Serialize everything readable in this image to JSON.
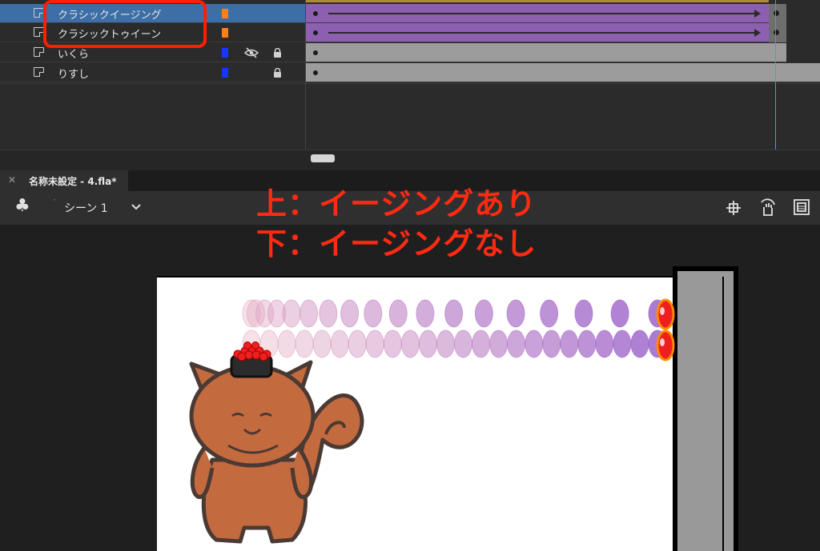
{
  "timeline": {
    "layers": [
      {
        "name": "クラシックイージング",
        "color": "#ff7f1a",
        "selected": true,
        "tween": true,
        "frames_color": "#8c5fb0"
      },
      {
        "name": "クラシックトゥイーン",
        "color": "#ff7f1a",
        "selected": false,
        "tween": true,
        "frames_color": "#8c5fb0"
      },
      {
        "name": "いくら",
        "color": "#1438ff",
        "selected": false,
        "tween": false,
        "hidden": true,
        "locked": true,
        "frames_color": "#9c9c9c"
      },
      {
        "name": "りすし",
        "color": "#1438ff",
        "selected": false,
        "tween": false,
        "hidden": false,
        "locked": true,
        "frames_color": "#9c9c9c"
      }
    ]
  },
  "document": {
    "tab_title": "名称未設定 - 4.fla*",
    "close_icon": "close-icon"
  },
  "toolbar": {
    "scene_label": "シーン 1",
    "scene_icon": "clubs-icon",
    "dropdown_icon": "chevron-down-icon",
    "right_icons": [
      "center-stage-icon",
      "rotate-stage-icon",
      "clip-icon"
    ]
  },
  "annotation": {
    "line1": "上：イージングあり",
    "line2": "下：イージングなし",
    "color": "#ff2a12"
  },
  "colors": {
    "accent_highlight": "#ff1e00",
    "playhead": "#3ea0e0",
    "ikura_red": "#ee1f1f",
    "squirrel_brown": "#c46a3f"
  }
}
